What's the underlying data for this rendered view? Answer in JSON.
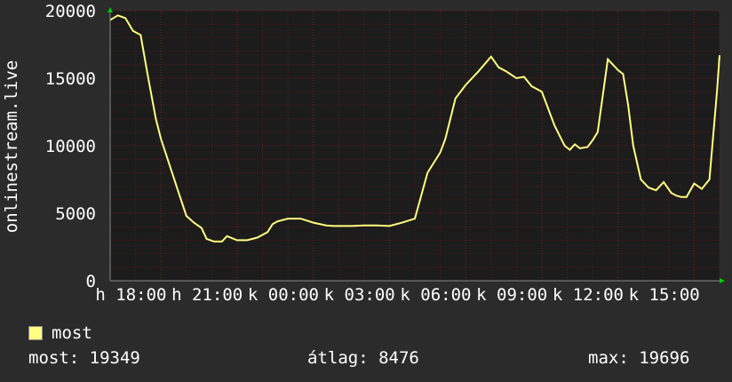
{
  "chart_data": {
    "type": "line",
    "ylabel": "onlinestream.live",
    "ylim": [
      0,
      20000
    ],
    "yticks": [
      0,
      5000,
      10000,
      15000,
      20000
    ],
    "xlim": [
      16.4,
      16.4
    ],
    "x_tick_labels": [
      "h 18:00",
      "h 21:00",
      "k 00:00",
      "k 03:00",
      "k 06:00",
      "k 09:00",
      "k 12:00",
      "k 15:00"
    ],
    "grid": true,
    "line_color": "#ffff80",
    "background": "#1c1c1c",
    "grid_color": "#8b1a1a",
    "series": [
      {
        "name": "most",
        "x": [
          0,
          0.3,
          0.6,
          0.9,
          1.2,
          1.5,
          1.8,
          2.0,
          2.3,
          2.7,
          3.0,
          3.3,
          3.6,
          3.8,
          4.1,
          4.4,
          4.6,
          5.0,
          5.4,
          5.8,
          6.2,
          6.4,
          6.6,
          7.0,
          7.5,
          8.0,
          8.5,
          8.8,
          9.1,
          9.5,
          10.0,
          10.5,
          11.0,
          11.5,
          12.0,
          12.5,
          13.0,
          13.2,
          13.6,
          14.0,
          14.5,
          15.0,
          15.3,
          15.6,
          16.0,
          16.3,
          16.6,
          17.0,
          17.5,
          17.9,
          18.1,
          18.3,
          18.5,
          18.8,
          19.0,
          19.2,
          19.6,
          20.0,
          20.2,
          20.4,
          20.6,
          20.9,
          21.2,
          21.5,
          21.8,
          22.1,
          22.3,
          22.5,
          22.7,
          23.0,
          23.3,
          23.6,
          23.9,
          24.0
        ],
        "values": [
          19300,
          19650,
          19450,
          18500,
          18200,
          15000,
          12000,
          10500,
          8800,
          6500,
          4800,
          4300,
          3900,
          3100,
          2900,
          2900,
          3300,
          3000,
          3000,
          3200,
          3600,
          4200,
          4400,
          4600,
          4600,
          4300,
          4100,
          4050,
          4050,
          4050,
          4100,
          4100,
          4050,
          4300,
          4600,
          8000,
          9500,
          10500,
          13500,
          14500,
          15500,
          16600,
          15800,
          15500,
          15000,
          15100,
          14400,
          14000,
          11500,
          10000,
          9700,
          10100,
          9800,
          9900,
          10400,
          11000,
          16400,
          15600,
          15300,
          13000,
          10000,
          7500,
          6900,
          6700,
          7300,
          6500,
          6300,
          6200,
          6200,
          7200,
          6800,
          7500,
          14000,
          16700
        ]
      }
    ]
  },
  "legend": {
    "swatch_color": "#ffff80",
    "label": "most"
  },
  "stats": {
    "current": "most: 19349",
    "average": "átlag: 8476",
    "max": "max: 19696"
  }
}
